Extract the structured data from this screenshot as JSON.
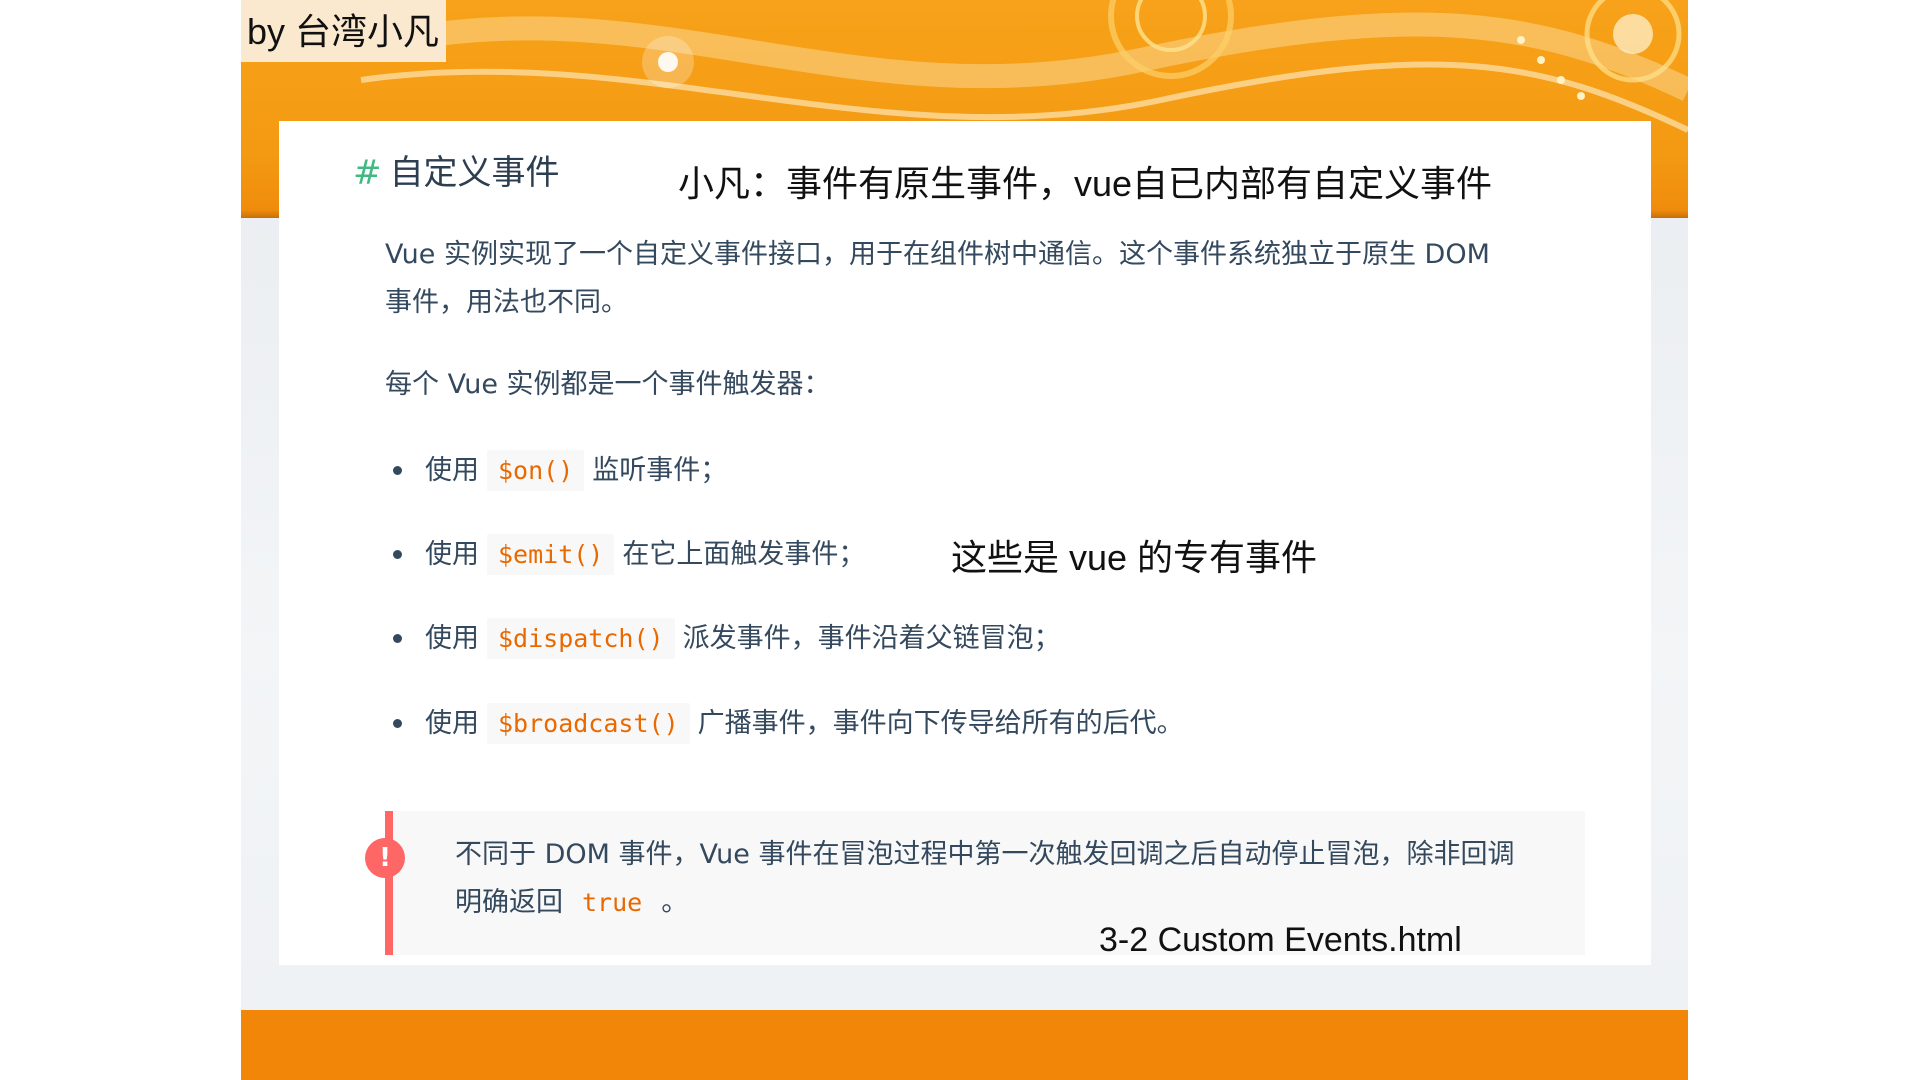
{
  "byline": "by 台湾小凡",
  "heading": {
    "hash": "#",
    "title": "自定义事件"
  },
  "annotations": {
    "top_note": "小凡：事件有原生事件，vue自已内部有自定义事件",
    "vue_note": "这些是 vue 的专有事件",
    "filename": "3-2 Custom Events.html"
  },
  "paragraphs": {
    "intro": "Vue 实例实现了一个自定义事件接口，用于在组件树中通信。这个事件系统独立于原生 DOM 事件，用法也不同。",
    "lead": "每个 Vue 实例都是一个事件触发器："
  },
  "methods": [
    {
      "prefix": "使用",
      "code": "$on()",
      "desc": "监听事件；"
    },
    {
      "prefix": "使用",
      "code": "$emit()",
      "desc": "在它上面触发事件；"
    },
    {
      "prefix": "使用",
      "code": "$dispatch()",
      "desc": "派发事件，事件沿着父链冒泡；"
    },
    {
      "prefix": "使用",
      "code": "$broadcast()",
      "desc": "广播事件，事件向下传导给所有的后代。"
    }
  ],
  "tip": {
    "icon": "!",
    "text_before": "不同于 DOM 事件，Vue 事件在冒泡过程中第一次触发回调之后自动停止冒泡，除非回调明确返回",
    "code": "true",
    "text_after": "。"
  },
  "colors": {
    "accent_green": "#42b983",
    "code_orange": "#e96900",
    "tip_red": "#ff6666",
    "band_orange": "#f39a12"
  }
}
